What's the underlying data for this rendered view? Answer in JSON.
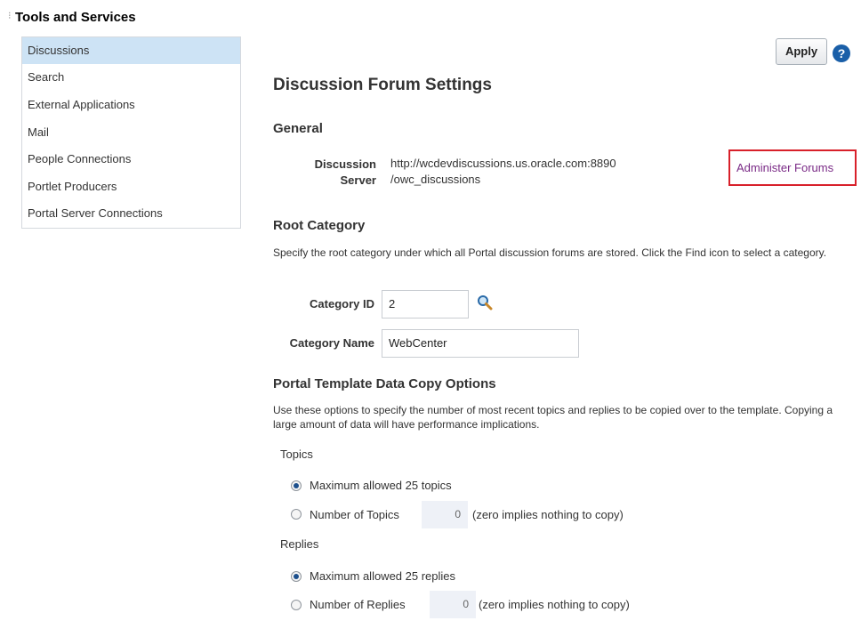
{
  "sidebar": {
    "title": "Tools and Services",
    "items": [
      {
        "label": "Discussions",
        "selected": true
      },
      {
        "label": "Search"
      },
      {
        "label": "External Applications"
      },
      {
        "label": "Mail"
      },
      {
        "label": "People Connections"
      },
      {
        "label": "Portlet Producers"
      },
      {
        "label": "Portal Server Connections"
      }
    ]
  },
  "toolbar": {
    "apply_label": "Apply",
    "help_icon": "?"
  },
  "page": {
    "title": "Discussion Forum Settings"
  },
  "general": {
    "heading": "General",
    "server_label_line1": "Discussion",
    "server_label_line2": "Server",
    "server_value_line1": "http://wcdevdiscussions.us.oracle.com:8890",
    "server_value_line2": "/owc_discussions",
    "administer_link": "Administer Forums"
  },
  "root_category": {
    "heading": "Root Category",
    "description": "Specify the root category under which all Portal discussion forums are stored. Click the Find icon to select a category.",
    "category_id_label": "Category ID",
    "category_id_value": "2",
    "category_name_label": "Category Name",
    "category_name_value": "WebCenter"
  },
  "copy_options": {
    "heading": "Portal Template Data Copy Options",
    "description": "Use these options to specify the number of most recent topics and replies to be copied over to the template. Copying a large amount of data will have performance implications.",
    "topics": {
      "label": "Topics",
      "option_max": "Maximum allowed 25 topics",
      "option_number": "Number of Topics",
      "number_value": "0",
      "hint": "(zero implies nothing to copy)",
      "selected": "max"
    },
    "replies": {
      "label": "Replies",
      "option_max": "Maximum allowed 25 replies",
      "option_number": "Number of Replies",
      "number_value": "0",
      "hint": "(zero implies nothing to copy)",
      "selected": "max"
    }
  },
  "colors": {
    "accent": "#1a5fa8",
    "selection": "#cde3f5",
    "link": "#7a2a86",
    "highlight_box": "#d8202a"
  }
}
